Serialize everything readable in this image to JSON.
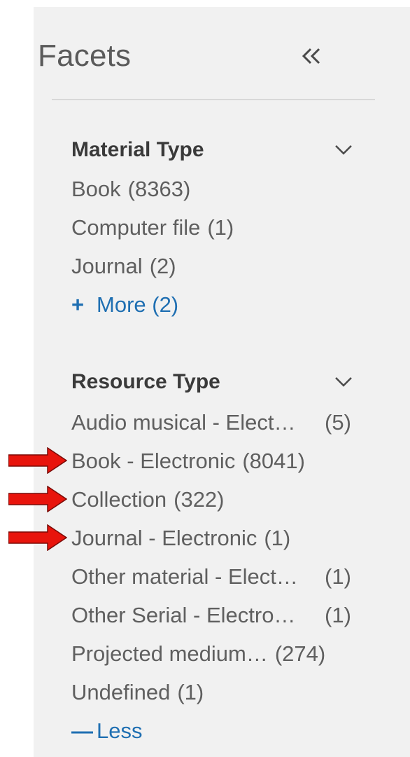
{
  "panel": {
    "title": "Facets",
    "collapse_glyph": "«"
  },
  "material_type": {
    "title": "Material Type",
    "items": [
      {
        "label": "Book",
        "count": "(8363)"
      },
      {
        "label": "Computer file",
        "count": "(1)"
      },
      {
        "label": "Journal",
        "count": "(2)"
      }
    ],
    "more_symbol": "+",
    "more_label": "More (2)"
  },
  "resource_type": {
    "title": "Resource Type",
    "items": [
      {
        "label": "Audio musical - Elect…",
        "count": "(5)"
      },
      {
        "label": "Book - Electronic",
        "count": "(8041)"
      },
      {
        "label": "Collection",
        "count": "(322)"
      },
      {
        "label": "Journal - Electronic",
        "count": "(1)"
      },
      {
        "label": "Other material - Elect…",
        "count": "(1)"
      },
      {
        "label": "Other Serial - Electro…",
        "count": "(1)"
      },
      {
        "label": "Projected medium…",
        "count": "(274)"
      },
      {
        "label": "Undefined",
        "count": "(1)"
      }
    ],
    "less_symbol": "—",
    "less_label": "Less"
  },
  "colors": {
    "panel_bg": "#f1f1f1",
    "link": "#1f6fb2",
    "annotation_arrow": "#e8140c"
  },
  "icons": {
    "collapse": "double-chevron-left-icon",
    "expand": "chevron-down-icon",
    "annotation": "red-arrow-icon"
  }
}
